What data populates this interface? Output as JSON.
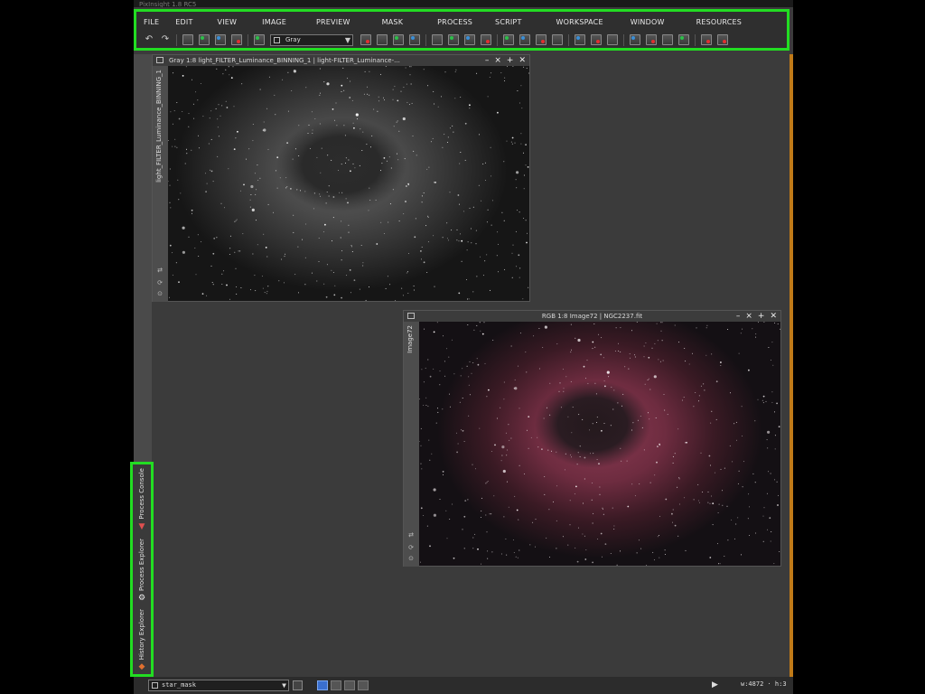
{
  "app": {
    "title": "PixInsight 1.8 RC5"
  },
  "menu": [
    "FILE",
    "EDIT",
    "VIEW",
    "IMAGE",
    "PREVIEW",
    "MASK",
    "PROCESS",
    "SCRIPT",
    "WORKSPACE",
    "WINDOW",
    "RESOURCES"
  ],
  "toolbar": {
    "view_select_value": "Gray",
    "icons": [
      "undo-icon",
      "redo-icon",
      "sep",
      "window-icon",
      "new-image-icon",
      "duplicate-icon",
      "mask-icon",
      "sep",
      "screen-transfer-icon",
      "select",
      "zoom-in-icon",
      "zoom-out-icon",
      "zoom-1-1-icon",
      "zoom-fit-icon",
      "sep",
      "readout-icon",
      "pan-icon",
      "preview-icon",
      "preview-edit-icon",
      "sep",
      "mask-show-icon",
      "mask-invert-icon",
      "mask-enable-icon",
      "mask-disable-icon",
      "sep",
      "stf-icon",
      "stf-auto-icon",
      "stf-reset-icon",
      "sep",
      "explorer-icon",
      "explorer-add-icon",
      "explorer-grid-icon",
      "explorer-list-icon",
      "sep",
      "process-list-icon",
      "process-stop-icon"
    ]
  },
  "windows": {
    "gray": {
      "title": "Gray 1:8 light_FILTER_Luminance_BINNING_1 | light-FILTER_Luminance-...",
      "tab_label": "light_FILTER_Luminance_BINNING_1"
    },
    "rgb": {
      "title": "RGB 1:8 Image72 | NGC2237.fit",
      "tab_label": "Image72"
    }
  },
  "side_panels": [
    {
      "label": "Process Console",
      "icon": "process-console-icon"
    },
    {
      "label": "Process Explorer",
      "icon": "process-explorer-icon"
    },
    {
      "label": "History Explorer",
      "icon": "history-explorer-icon"
    }
  ],
  "statusbar": {
    "view_select_value": "star_mask",
    "coords": "w:4872 · h:3"
  },
  "colors": {
    "highlight": "#22dd22",
    "accent_edge": "#c07a18",
    "workspace_active": "#3a6fd0"
  }
}
